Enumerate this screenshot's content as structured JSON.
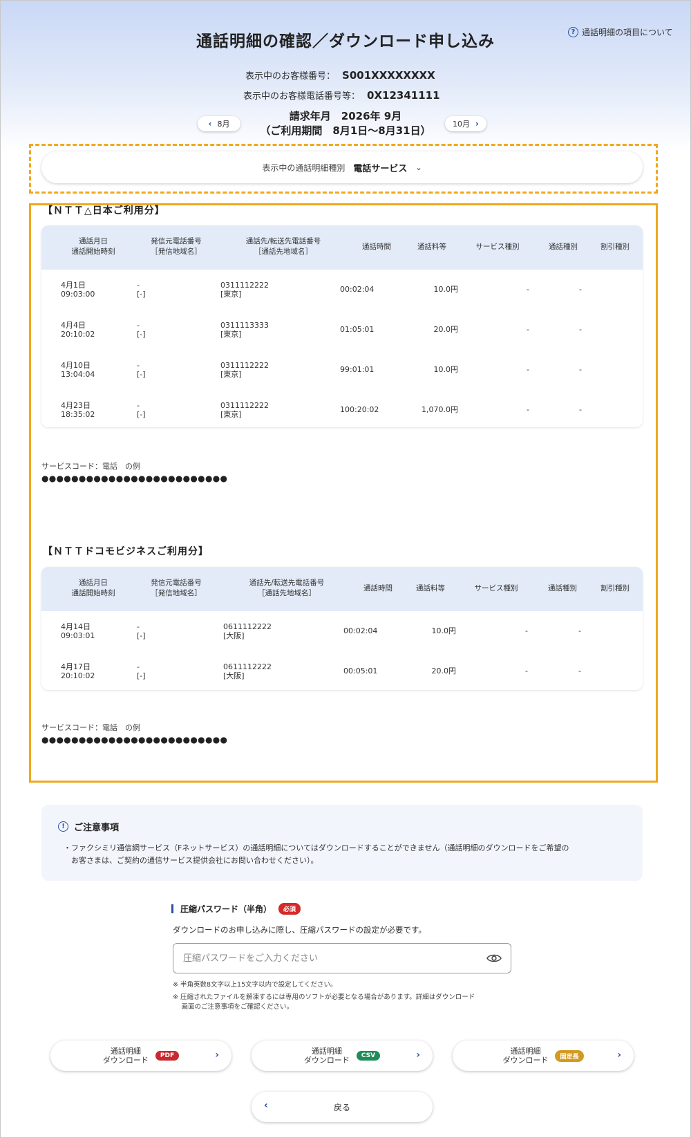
{
  "header": {
    "title": "通話明細の確認／ダウンロード申し込み",
    "help_link": "通話明細の項目について"
  },
  "customer": {
    "number_label": "表示中のお客様番号：",
    "number": "S001XXXXXXXX",
    "phone_label": "表示中のお客様電話番号等：",
    "phone": "0X12341111"
  },
  "period": {
    "billing": "請求年月　2026年 9月",
    "usage": "（ご利用期間　8月1日〜8月31日）",
    "prev_label": "8月",
    "next_label": "10月"
  },
  "type_selector": {
    "label": "表示中の通話明細種別",
    "value": "電話サービス"
  },
  "table_headers": {
    "date_l1": "通話月日",
    "date_l2": "通話開始時刻",
    "from_l1": "発信元電話番号",
    "from_l2": "［発信地域名］",
    "to_l1": "通話先/転送先電話番号",
    "to_l2": "［通話先地域名］",
    "duration": "通話時間",
    "fee": "通話料等",
    "service": "サービス種別",
    "call_type": "通話種別",
    "discount": "割引種別"
  },
  "sections": [
    {
      "title": "【ＮＴＴ△日本ご利用分】",
      "rows": [
        {
          "date": "4月1日",
          "time": "09:03:00",
          "from": "-",
          "from_area": "[-]",
          "to": "0311112222",
          "to_area": "[東京]",
          "duration": "00:02:04",
          "fee": "10.0円",
          "service": "-",
          "call_type": "-",
          "discount": "-"
        },
        {
          "date": "4月4日",
          "time": "20:10:02",
          "from": "-",
          "from_area": "[-]",
          "to": "0311113333",
          "to_area": "[東京]",
          "duration": "01:05:01",
          "fee": "20.0円",
          "service": "-",
          "call_type": "-",
          "discount": "-"
        },
        {
          "date": "4月10日",
          "time": "13:04:04",
          "from": "-",
          "from_area": "[-]",
          "to": "0311112222",
          "to_area": "[東京]",
          "duration": "99:01:01",
          "fee": "10.0円",
          "service": "-",
          "call_type": "-",
          "discount": "-"
        },
        {
          "date": "4月23日",
          "time": "18:35:02",
          "from": "-",
          "from_area": "[-]",
          "to": "0311112222",
          "to_area": "[東京]",
          "duration": "100:20:02",
          "fee": "1,070.0円",
          "service": "-",
          "call_type": "-",
          "discount": "-"
        }
      ],
      "service_code_label": "サービスコード：電話　の例",
      "service_code_value": "●●●●●●●●●●●●●●●●●●●●●●●●●"
    },
    {
      "title": "【ＮＴＴドコモビジネスご利用分】",
      "rows": [
        {
          "date": "4月14日",
          "time": "09:03:01",
          "from": "-",
          "from_area": "[-]",
          "to": "0611112222",
          "to_area": "[大阪]",
          "duration": "00:02:04",
          "fee": "10.0円",
          "service": "-",
          "call_type": "-",
          "discount": "-"
        },
        {
          "date": "4月17日",
          "time": "20:10:02",
          "from": "-",
          "from_area": "[-]",
          "to": "0611112222",
          "to_area": "[大阪]",
          "duration": "00:05:01",
          "fee": "20.0円",
          "service": "-",
          "call_type": "-",
          "discount": "-"
        }
      ],
      "service_code_label": "サービスコード：電話　の例",
      "service_code_value": "●●●●●●●●●●●●●●●●●●●●●●●●●"
    }
  ],
  "notice": {
    "title": "ご注意事項",
    "line1": "・ファクシミリ通信網サービス（Fネットサービス）の通話明細についてはダウンロードすることができません（通話明細のダウンロードをご希望の",
    "line2": "　お客さまは、ご契約の通信サービス提供会社にお問い合わせください）。"
  },
  "password": {
    "label": "圧縮パスワード（半角）",
    "required": "必須",
    "description": "ダウンロードのお申し込みに際し、圧縮パスワードの設定が必要です。",
    "placeholder": "圧縮パスワードをご入力ください",
    "value": "",
    "note1": "※ 半角英数8文字以上15文字以内で設定してください。",
    "note2a": "※ 圧縮されたファイルを解凍するには専用のソフトが必要となる場合があります。詳細はダウンロード",
    "note2b": "　 画面のご注意事項をご確認ください。"
  },
  "downloads": [
    {
      "line1": "通話明細",
      "line2": "ダウンロード",
      "badge": "PDF"
    },
    {
      "line1": "通話明細",
      "line2": "ダウンロード",
      "badge": "CSV"
    },
    {
      "line1": "通話明細",
      "line2": "ダウンロード",
      "badge": "固定長"
    }
  ],
  "back_label": "戻る",
  "colors": {
    "accent": "#2b4fa0",
    "highlight": "#f0a81c",
    "required": "#d42a2a",
    "pdf": "#c8282e",
    "csv": "#1f8c5a",
    "fixed": "#d39a22"
  }
}
